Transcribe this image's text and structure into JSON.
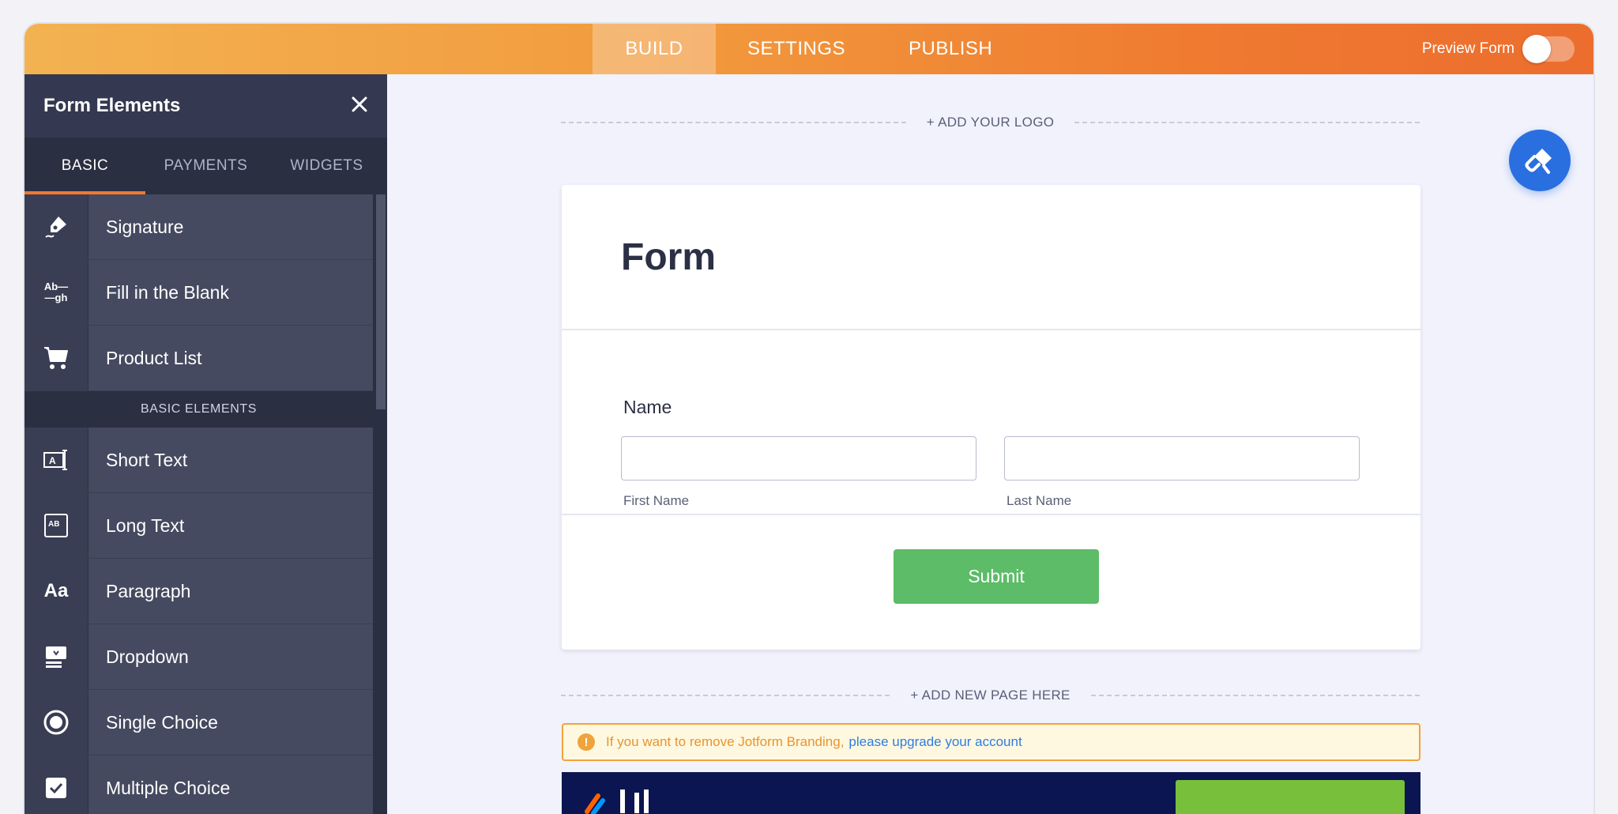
{
  "topbar": {
    "tabs": [
      {
        "label": "BUILD",
        "active": true
      },
      {
        "label": "SETTINGS",
        "active": false
      },
      {
        "label": "PUBLISH",
        "active": false
      }
    ],
    "preview_label": "Preview Form",
    "preview_on": false
  },
  "sidebar": {
    "title": "Form Elements",
    "tabs": [
      {
        "label": "BASIC",
        "active": true
      },
      {
        "label": "PAYMENTS",
        "active": false
      },
      {
        "label": "WIDGETS",
        "active": false
      }
    ],
    "items_top": [
      {
        "label": "Signature",
        "icon": "signature-icon"
      },
      {
        "label": "Fill in the Blank",
        "icon": "fill-blank-icon"
      },
      {
        "label": "Product List",
        "icon": "cart-icon"
      }
    ],
    "section_label": "BASIC ELEMENTS",
    "items_basic": [
      {
        "label": "Short Text",
        "icon": "short-text-icon"
      },
      {
        "label": "Long Text",
        "icon": "long-text-icon"
      },
      {
        "label": "Paragraph",
        "icon": "paragraph-icon",
        "glyph": "Aa"
      },
      {
        "label": "Dropdown",
        "icon": "dropdown-icon"
      },
      {
        "label": "Single Choice",
        "icon": "radio-icon"
      },
      {
        "label": "Multiple Choice",
        "icon": "checkbox-icon"
      }
    ],
    "fill_blank_glyph_top": "Ab",
    "fill_blank_glyph_bottom": "gh",
    "long_text_glyph": "AB"
  },
  "canvas": {
    "add_logo": "+ ADD YOUR LOGO",
    "form_title": "Form",
    "field_label": "Name",
    "first_name_sublabel": "First Name",
    "last_name_sublabel": "Last Name",
    "submit_label": "Submit",
    "add_page": "+ ADD NEW PAGE HERE",
    "notice_text": "If you want to remove Jotform Branding,",
    "notice_link": "please upgrade your account",
    "notice_icon": "!"
  },
  "colors": {
    "accent": "#ef7a30",
    "submit": "#5cbc67",
    "fab": "#2a6fe0",
    "sidebar_bg": "#2b2f42"
  }
}
